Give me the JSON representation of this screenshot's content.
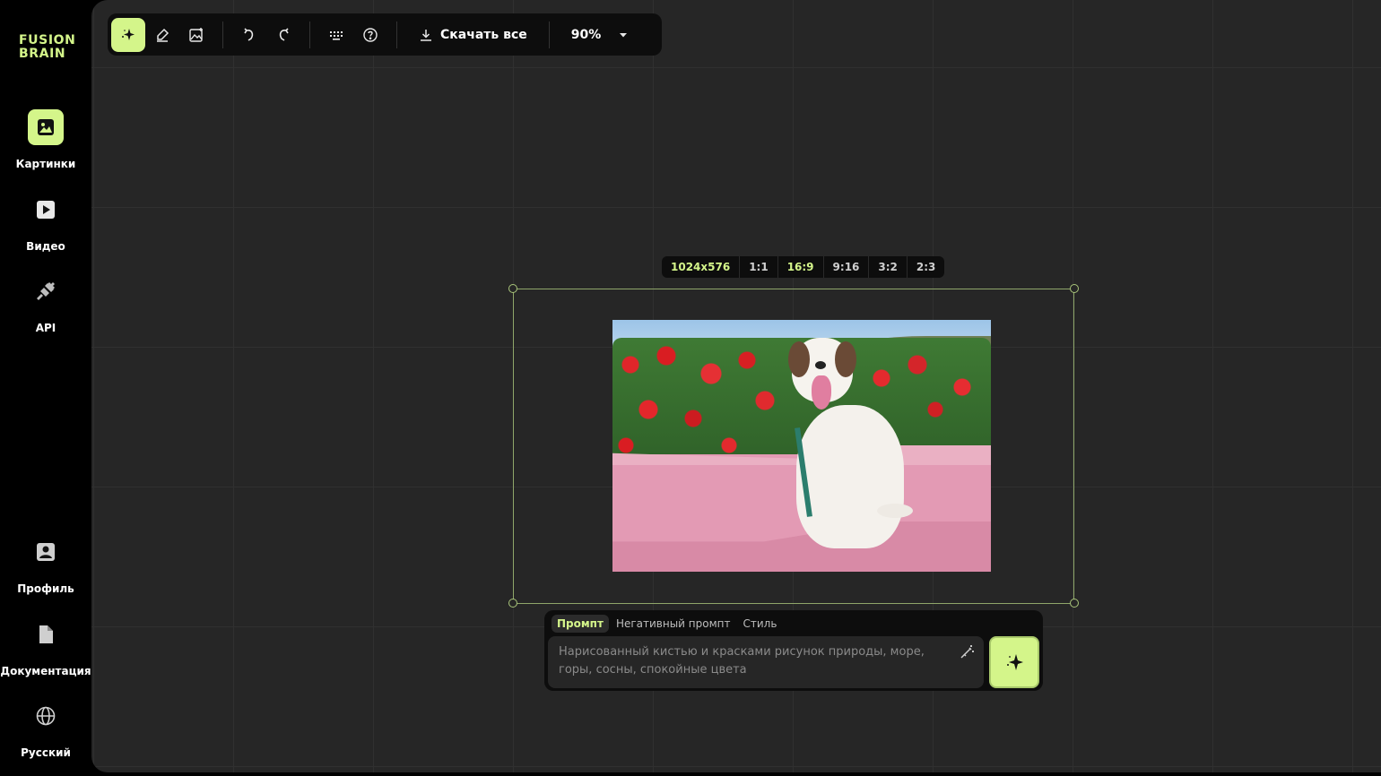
{
  "app": {
    "logo_line1": "FUSION",
    "logo_line2": "BRAIN",
    "accent_color": "#d4f58a"
  },
  "sidebar": {
    "items": [
      {
        "label": "Картинки",
        "icon": "image-icon",
        "active": true
      },
      {
        "label": "Видео",
        "icon": "play-icon",
        "active": false
      },
      {
        "label": "API",
        "icon": "plug-icon",
        "active": false
      },
      {
        "label": "Профиль",
        "icon": "profile-icon",
        "active": false
      },
      {
        "label": "Документация",
        "icon": "document-icon",
        "active": false
      },
      {
        "label": "Русский",
        "icon": "globe-icon",
        "active": false
      }
    ]
  },
  "toolbar": {
    "tools": [
      {
        "icon": "sparkle-icon",
        "active": true
      },
      {
        "icon": "eraser-icon",
        "active": false
      },
      {
        "icon": "image-plus-icon",
        "active": false
      },
      {
        "icon": "undo-icon",
        "active": false
      },
      {
        "icon": "redo-icon",
        "active": false
      },
      {
        "icon": "keyboard-icon",
        "active": false
      },
      {
        "icon": "help-icon",
        "active": false
      }
    ],
    "download_label": "Скачать все",
    "zoom_value": "90%"
  },
  "ratio_bar": {
    "resolution": "1024x576",
    "options": [
      "1:1",
      "16:9",
      "9:16",
      "3:2",
      "2:3"
    ],
    "selected": "16:9"
  },
  "prompt": {
    "tabs": [
      "Промпт",
      "Негативный промпт",
      "Стиль"
    ],
    "active_tab": "Промпт",
    "placeholder": "Нарисованный кистью и красками рисунок природы, море, горы, сосны, спокойные цвета",
    "value": ""
  }
}
